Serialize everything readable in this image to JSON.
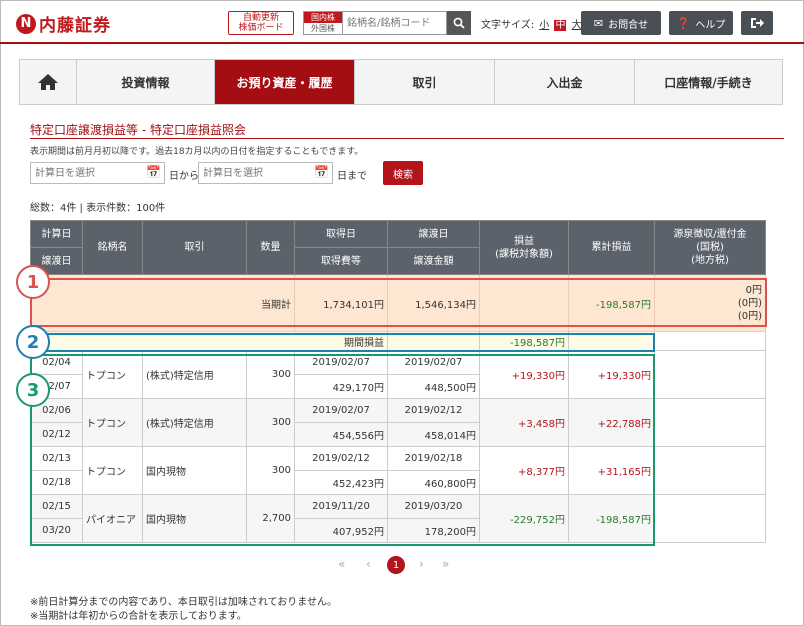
{
  "header": {
    "logo_mark": "N",
    "logo_text": "内藤証券",
    "auto_board_l1": "自動更新",
    "auto_board_l2": "株価ボード",
    "market_domestic": "国内株",
    "market_foreign": "外国株",
    "search_placeholder": "銘柄名/銘柄コード",
    "font_size_label": "文字サイズ:",
    "font_small": "小",
    "font_medium": "中",
    "font_large": "大",
    "contact_label": "お問合せ",
    "help_label": "ヘルプ"
  },
  "nav": {
    "items": [
      "投資情報",
      "お預り資産・履歴",
      "取引",
      "入出金",
      "口座情報/手続き"
    ]
  },
  "page": {
    "title": "特定口座譲渡損益等 - 特定口座損益照会",
    "note": "表示期間は前月月初以降です。過去18カ月以内の日付を指定することもできます。",
    "date_from_placeholder": "計算日を選択",
    "date_from_suffix": "日から",
    "date_to_placeholder": "計算日を選択",
    "date_to_suffix": "日まで",
    "search_button": "検索",
    "count": "総数：4件 | 表示件数：100件"
  },
  "table": {
    "headers": {
      "calc_date": "計算日",
      "transfer_date_h": "譲渡日",
      "issue": "銘柄名",
      "trade": "取引",
      "qty": "数量",
      "acq_date": "取得日",
      "acq_cost": "取得費等",
      "sell_date": "譲渡日",
      "sell_amount": "譲渡金額",
      "pl_l1": "損益",
      "pl_l2": "(課税対象額)",
      "cum_pl": "累計損益",
      "tax_l1": "源泉徴収/還付金",
      "tax_l2": "(国税)",
      "tax_l3": "(地方税)"
    },
    "total": {
      "label": "当期計",
      "acq_cost": "1,734,101円",
      "sell_amount": "1,546,134円",
      "cum_pl": "-198,587円",
      "tax1": "0円",
      "tax2": "(0円)",
      "tax3": "(0円)"
    },
    "period": {
      "label": "期間損益",
      "value": "-198,587円"
    },
    "rows": [
      {
        "d1": "02/04",
        "d2": "02/07",
        "name": "トプコン",
        "trade": "(株式)特定信用",
        "qty": "300",
        "acq_date": "2019/02/07",
        "acq_cost": "429,170円",
        "sell_date": "2019/02/07",
        "sell_amount": "448,500円",
        "pl": "+19,330円",
        "cum": "+19,330円"
      },
      {
        "d1": "02/06",
        "d2": "02/12",
        "name": "トプコン",
        "trade": "(株式)特定信用",
        "qty": "300",
        "acq_date": "2019/02/07",
        "acq_cost": "454,556円",
        "sell_date": "2019/02/12",
        "sell_amount": "458,014円",
        "pl": "+3,458円",
        "cum": "+22,788円"
      },
      {
        "d1": "02/13",
        "d2": "02/18",
        "name": "トプコン",
        "trade": "国内現物",
        "qty": "300",
        "acq_date": "2019/02/12",
        "acq_cost": "452,423円",
        "sell_date": "2019/02/18",
        "sell_amount": "460,800円",
        "pl": "+8,377円",
        "cum": "+31,165円"
      },
      {
        "d1": "02/15",
        "d2": "03/20",
        "name": "パイオニア",
        "trade": "国内現物",
        "qty": "2,700",
        "acq_date": "2019/11/20",
        "acq_cost": "407,952円",
        "sell_date": "2019/03/20",
        "sell_amount": "178,200円",
        "pl": "-229,752円",
        "cum": "-198,587円"
      }
    ]
  },
  "annotations": {
    "c1": "1",
    "c2": "2",
    "c3": "3",
    "color1": "#d9534f",
    "color2": "#1f7fb0",
    "color3": "#1a9a6b"
  },
  "pagination": {
    "first": "«",
    "prev": "‹",
    "current": "1",
    "next": "›",
    "last": "»"
  },
  "footer": {
    "note1": "※前日計算分までの内容であり、本日取引は加味されておりません。",
    "note2": "※当期計は年初からの合計を表示しております。"
  }
}
